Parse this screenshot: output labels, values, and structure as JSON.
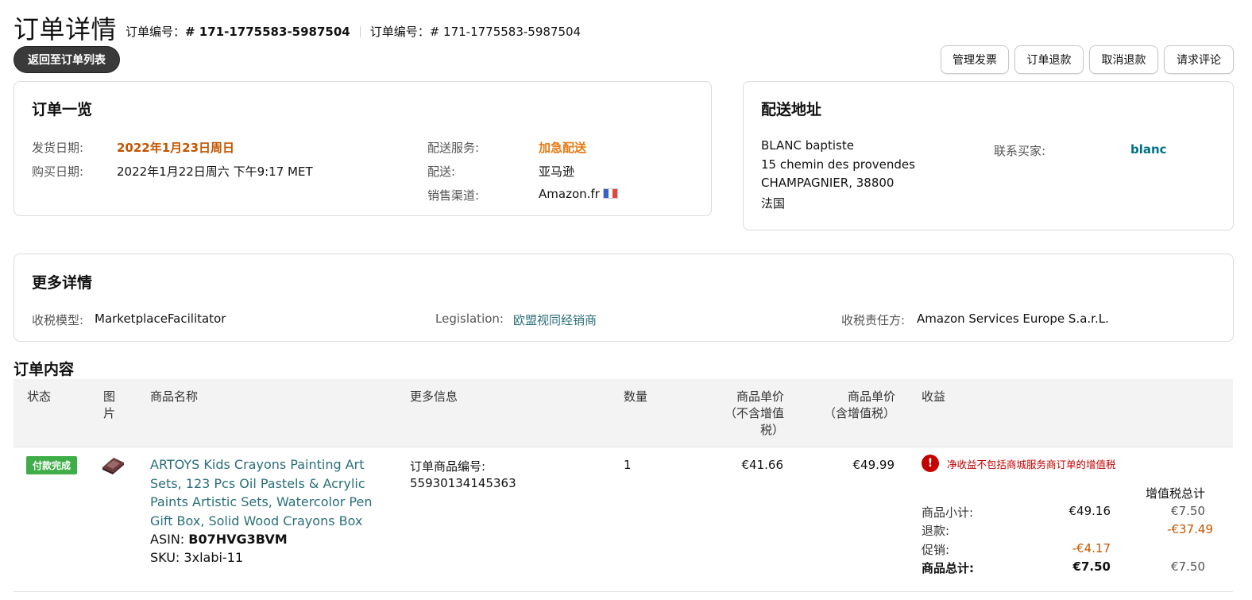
{
  "header": {
    "title": "订单详情",
    "order_label_1": "订单编号：",
    "order_id_1": "# 171-1775583-5987504",
    "order_label_2": "订单编号：",
    "order_id_2": "# 171-1775583-5987504",
    "back_button": "返回至订单列表"
  },
  "actions": [
    "管理发票",
    "订单退款",
    "取消退款",
    "请求评论"
  ],
  "overview": {
    "title": "订单一览",
    "ship_date_label": "发货日期:",
    "ship_date_value": "2022年1月23日周日",
    "purchase_date_label": "购买日期:",
    "purchase_date_value": "2022年1月22日周六 下午9:17 MET",
    "ship_service_label": "配送服务:",
    "ship_service_value": "加急配送",
    "fulfillment_label": "配送:",
    "fulfillment_value": "亚马逊",
    "channel_label": "销售渠道:",
    "channel_value": "Amazon.fr"
  },
  "shipping": {
    "title": "配送地址",
    "line1": "BLANC baptiste",
    "line2": "15 chemin des provendes",
    "line3": "CHAMPAGNIER, 38800",
    "line4": "法国",
    "contact_label": "联系买家:",
    "contact_value": "blanc"
  },
  "more": {
    "title": "更多详情",
    "tax_model_label": "收税模型:",
    "tax_model_value": "MarketplaceFacilitator",
    "legislation_label": "Legislation:",
    "legislation_value": "欧盟视同经销商",
    "tax_party_label": "收税责任方:",
    "tax_party_value": "Amazon Services Europe S.a.r.L."
  },
  "contents": {
    "title": "订单内容",
    "columns": {
      "status": "状态",
      "image_1": "图",
      "image_2": "片",
      "name": "商品名称",
      "more_info": "更多信息",
      "qty": "数量",
      "price_ex_1": "商品单价",
      "price_ex_2": "（不含增值",
      "price_ex_3": "税）",
      "price_inc_1": "商品单价",
      "price_inc_2": "（含增值税）",
      "proceeds": "收益"
    },
    "row": {
      "status": "付款完成",
      "title": "ARTOYS Kids Crayons Painting Art Sets, 123 Pcs Oil Pastels & Acrylic Paints Artistic Sets, Watercolor Pen Gift Box, Solid Wood Crayons Box",
      "asin_label": "ASIN:",
      "asin": "B07HVG3BVM",
      "sku_label": "SKU:",
      "sku": "3xlabi-11",
      "item_id_label": "订单商品编号:",
      "item_id": "55930134145363",
      "qty": "1",
      "price_ex": "€41.66",
      "price_inc": "€49.99"
    },
    "proceeds": {
      "warning": "净收益不包括商城服务商订单的增值税",
      "vat_total_header": "增值税总计",
      "subtotal_label": "商品小计:",
      "subtotal_value": "€49.16",
      "subtotal_vat": "€7.50",
      "refund_label": "退款:",
      "refund_vat": "-€37.49",
      "promo_label": "促销:",
      "promo_value": "-€4.17",
      "total_label": "商品总计:",
      "total_value": "€7.50",
      "total_vat": "€7.50"
    }
  },
  "colors": {
    "accent_orange": "#c45500",
    "link_teal": "#2a6e79",
    "status_green": "#3fae49",
    "warning_red": "#c40000"
  }
}
